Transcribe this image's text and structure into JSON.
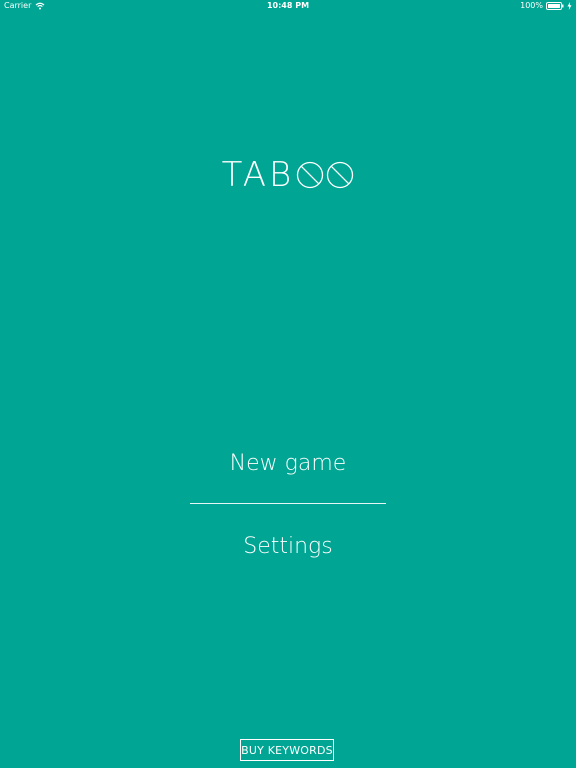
{
  "status_bar": {
    "carrier": "Carrier",
    "time": "10:48 PM",
    "battery": "100%",
    "icons": [
      "wifi-icon",
      "battery-icon",
      "charging-icon"
    ]
  },
  "title": {
    "text": "TAB",
    "logo_letters": [
      "no-symbol-o-icon",
      "no-symbol-o-icon"
    ]
  },
  "menu": {
    "new_game": "New game",
    "settings": "Settings"
  },
  "buy_keywords": "BUY KEYWORDS",
  "colors": {
    "background": "#00a693",
    "foreground": "#ffffff"
  }
}
